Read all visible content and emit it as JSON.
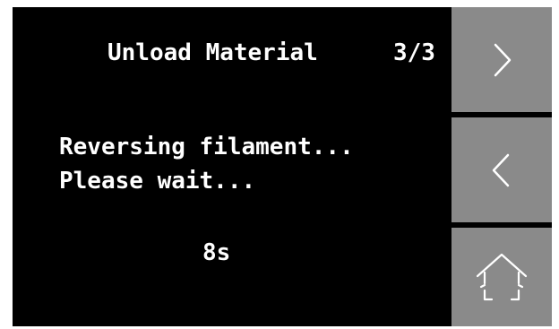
{
  "header": {
    "title": "Unload Material",
    "step": "3/3"
  },
  "status": {
    "line1": "Reversing filament...",
    "line2": "Please wait...",
    "countdown": "8s"
  },
  "sidebar": {
    "buttons": [
      {
        "name": "next",
        "icon": "chevron-right-icon"
      },
      {
        "name": "back",
        "icon": "chevron-left-icon"
      },
      {
        "name": "home",
        "icon": "home-icon"
      }
    ]
  },
  "colors": {
    "screen_background": "#000000",
    "text": "#ffffff",
    "button_background": "#8a8a8a",
    "icon_stroke": "#ffffff"
  }
}
